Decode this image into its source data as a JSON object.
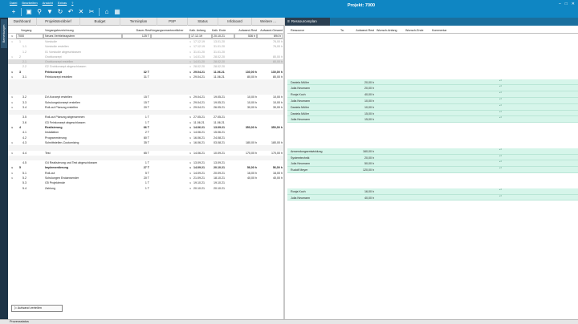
{
  "window": {
    "title": "Projekt: 7000",
    "side_tab": "Bemerkungen"
  },
  "menu": [
    "Datei",
    "Bearbeiten",
    "Ansicht",
    "Extras",
    "?"
  ],
  "tabs": [
    "Dashboard",
    "Projektsteckbrief",
    "Budget",
    "Terminplan",
    "PSP",
    "Status",
    "Infoboard",
    "Weitere ...",
    "Ressourcenplan"
  ],
  "grid": {
    "headers": [
      "Vorgang",
      "Vorgangsbezeichnung",
      "Dauer-Rest",
      "Vorgangsverantwortlicher",
      "Kalk. Anfang",
      "Kalk. Ende",
      "Aufwand-Rest",
      "Aufwand-Gesamt"
    ],
    "project": {
      "id": "7000",
      "name": "Neues Vertriebssystem",
      "dauer": "125 T",
      "verantwortlicher": "",
      "anfang": "17.12.19",
      "ende": "20.10.21",
      "rest": "536 h",
      "gesamt": "694 h"
    },
    "rows": [
      {
        "id": "1",
        "name": "Vorstudie",
        "dauer": "",
        "anfang": "17.12.19",
        "ende": "13.01.20",
        "rest": "",
        "gesamt": "76,00 h",
        "style": "gray",
        "level": 0,
        "toggle": true
      },
      {
        "id": "1.1",
        "name": "Vorstudie erstellen",
        "dauer": "",
        "anfang": "17.12.19",
        "ende": "31.01.20",
        "rest": "",
        "gesamt": "76,00 h",
        "style": "gray",
        "level": 1,
        "toggle": false
      },
      {
        "id": "1.2",
        "name": "01 Vorstudie abgeschlossen",
        "dauer": "",
        "anfang": "31.01.20",
        "ende": "31.01.20",
        "rest": "",
        "gesamt": "",
        "style": "gray",
        "level": 1,
        "toggle": false
      },
      {
        "id": "2",
        "name": "Grobkonzept",
        "dauer": "",
        "anfang": "14.01.20",
        "ende": "28.02.20",
        "rest": "",
        "gesamt": "80,00 h",
        "style": "gray",
        "level": 0,
        "toggle": true
      },
      {
        "id": "2.1",
        "name": "Grobkonzept erstellen",
        "dauer": "",
        "anfang": "14.01.20",
        "ende": "28.02.20",
        "rest": "",
        "gesamt": "80,00 h",
        "style": "gray sel",
        "level": 1,
        "toggle": false
      },
      {
        "id": "2.2",
        "name": "G2 Grobkonzept abgeschlossen",
        "dauer": "",
        "anfang": "28.02.20",
        "ende": "28.02.20",
        "rest": "",
        "gesamt": "",
        "style": "gray",
        "level": 1,
        "toggle": false
      },
      {
        "id": "3",
        "name": "Feinkonzept",
        "dauer": "32 T",
        "anfang": "29.04.21",
        "ende": "11.06.21",
        "rest": "130,00 h",
        "gesamt": "130,00 h",
        "style": "bold",
        "level": 0,
        "toggle": true
      },
      {
        "id": "3.1",
        "name": "Feinkonzept erstellen",
        "dauer": "31 T",
        "anfang": "29.04.21",
        "ende": "11.06.21",
        "rest": "80,00 h",
        "gesamt": "80,00 h",
        "style": "",
        "level": 1,
        "toggle": true
      },
      {
        "id": "",
        "name": "",
        "dauer": "",
        "anfang": "",
        "ende": "",
        "rest": "",
        "gesamt": "",
        "style": "ph",
        "level": 1,
        "toggle": false
      },
      {
        "id": "",
        "name": "",
        "dauer": "",
        "anfang": "",
        "ende": "",
        "rest": "",
        "gesamt": "",
        "style": "ph",
        "level": 1,
        "toggle": false
      },
      {
        "id": "",
        "name": "",
        "dauer": "",
        "anfang": "",
        "ende": "",
        "rest": "",
        "gesamt": "",
        "style": "ph",
        "level": 1,
        "toggle": false
      },
      {
        "id": "3.2",
        "name": "DV-Konzept erstellen",
        "dauer": "15 T",
        "anfang": "29.04.21",
        "ende": "19.05.21",
        "rest": "10,00 h",
        "gesamt": "10,00 h",
        "style": "",
        "level": 1,
        "toggle": true
      },
      {
        "id": "3.3",
        "name": "Schulungskonzept erstellen",
        "dauer": "15 T",
        "anfang": "29.04.21",
        "ende": "19.05.21",
        "rest": "10,00 h",
        "gesamt": "10,00 h",
        "style": "",
        "level": 1,
        "toggle": true
      },
      {
        "id": "3.4",
        "name": "Roll-out Planung erstellen",
        "dauer": "20 T",
        "anfang": "29.04.21",
        "ende": "26.05.21",
        "rest": "30,00 h",
        "gesamt": "30,00 h",
        "style": "",
        "level": 1,
        "toggle": true
      },
      {
        "id": "",
        "name": "",
        "dauer": "",
        "anfang": "",
        "ende": "",
        "rest": "",
        "gesamt": "",
        "style": "ph",
        "level": 1,
        "toggle": false
      },
      {
        "id": "3.5",
        "name": "Roll-out Planung abgenommen",
        "dauer": "1 T",
        "anfang": "27.05.21",
        "ende": "27.05.21",
        "rest": "",
        "gesamt": "",
        "style": "",
        "level": 1,
        "toggle": false
      },
      {
        "id": "3.6",
        "name": "G3 Feinkonzept abgeschlossen",
        "dauer": "1 T",
        "anfang": "11.06.21",
        "ende": "11.06.21",
        "rest": "",
        "gesamt": "",
        "style": "",
        "level": 1,
        "toggle": false
      },
      {
        "id": "4",
        "name": "Realisierung",
        "dauer": "66 T",
        "anfang": "14.06.21",
        "ende": "13.09.21",
        "rest": "350,00 h",
        "gesamt": "350,00 h",
        "style": "bold",
        "level": 0,
        "toggle": true
      },
      {
        "id": "4.1",
        "name": "Installation",
        "dauer": "2 T",
        "anfang": "14.06.21",
        "ende": "15.06.21",
        "rest": "",
        "gesamt": "",
        "style": "",
        "level": 1,
        "toggle": false
      },
      {
        "id": "4.2",
        "name": "Programmierung",
        "dauer": "80 T",
        "anfang": "16.06.21",
        "ende": "24.08.21",
        "rest": "",
        "gesamt": "",
        "style": "",
        "level": 1,
        "toggle": false
      },
      {
        "id": "4.3",
        "name": "Schnittstellen-Customizing",
        "dauer": "35 T",
        "anfang": "16.06.21",
        "ende": "03.08.21",
        "rest": "180,00 h",
        "gesamt": "180,00 h",
        "style": "",
        "level": 1,
        "toggle": true
      },
      {
        "id": "",
        "name": "",
        "dauer": "",
        "anfang": "",
        "ende": "",
        "rest": "",
        "gesamt": "",
        "style": "ph",
        "level": 1,
        "toggle": false
      },
      {
        "id": "4.4",
        "name": "Test",
        "dauer": "65 T",
        "anfang": "14.06.21",
        "ende": "10.09.21",
        "rest": "170,00 h",
        "gesamt": "170,00 h",
        "style": "",
        "level": 1,
        "toggle": true
      },
      {
        "id": "",
        "name": "",
        "dauer": "",
        "anfang": "",
        "ende": "",
        "rest": "",
        "gesamt": "",
        "style": "ph",
        "level": 1,
        "toggle": false
      },
      {
        "id": "4.5",
        "name": "G4 Realisierung und Test abgeschlossen",
        "dauer": "1 T",
        "anfang": "13.09.21",
        "ende": "13.09.21",
        "rest": "",
        "gesamt": "",
        "style": "",
        "level": 1,
        "toggle": false
      },
      {
        "id": "5",
        "name": "Implementierung",
        "dauer": "27 T",
        "anfang": "14.09.21",
        "ende": "20.10.21",
        "rest": "56,00 h",
        "gesamt": "56,00 h",
        "style": "bold",
        "level": 0,
        "toggle": true
      },
      {
        "id": "5.1",
        "name": "Roll-out",
        "dauer": "5 T",
        "anfang": "14.09.21",
        "ende": "20.09.21",
        "rest": "16,00 h",
        "gesamt": "16,00 h",
        "style": "",
        "level": 1,
        "toggle": true
      },
      {
        "id": "5.2",
        "name": "Schulungen Endanwender",
        "dauer": "20 T",
        "anfang": "21.09.21",
        "ende": "18.10.21",
        "rest": "40,00 h",
        "gesamt": "40,00 h",
        "style": "",
        "level": 1,
        "toggle": true
      },
      {
        "id": "5.3",
        "name": "G5 Projektende",
        "dauer": "1 T",
        "anfang": "19.10.21",
        "ende": "19.10.21",
        "rest": "",
        "gesamt": "",
        "style": "",
        "level": 1,
        "toggle": false
      },
      {
        "id": "5.4",
        "name": "Zahlung",
        "dauer": "1 T",
        "anfang": "20.10.21",
        "ende": "20.10.21",
        "rest": "",
        "gesamt": "",
        "style": "",
        "level": 1,
        "toggle": false
      }
    ]
  },
  "resources": {
    "headers": [
      "Ressource",
      "Ta.",
      "Aufwand-Rest",
      "Wunsch-Anfang",
      "Wunsch-Ende",
      "Kommentar"
    ],
    "rows": [
      {
        "gap": 9
      },
      {
        "name": "Daniela Müller",
        "rest": "20,00 h"
      },
      {
        "name": "Julia Neumann",
        "rest": "20,00 h"
      },
      {
        "name": "Ronja Koch",
        "rest": "40,00 h"
      },
      {
        "name": "Julia Neumann",
        "rest": "10,00 h"
      },
      {
        "name": "Daniela Müller",
        "rest": "10,00 h"
      },
      {
        "name": "Daniela Müller",
        "rest": "15,00 h"
      },
      {
        "name": "Julia Neumann",
        "rest": "15,00 h"
      },
      {
        "gap": 5
      },
      {
        "name": "Anwendungsentwicklung",
        "rest": "160,00 h"
      },
      {
        "name": "Systemtechnik",
        "rest": "20,00 h"
      },
      {
        "name": "Julia Neumann",
        "rest": "50,00 h"
      },
      {
        "name": "Rudolf Meyer",
        "rest": "120,00 h"
      },
      {
        "gap": 3
      },
      {
        "name": "Ronja Koch",
        "rest": "16,00 h"
      },
      {
        "name": "Julia Neumann",
        "rest": "40,00 h"
      }
    ]
  },
  "footer": {
    "button": "Aufwand verteilen",
    "status": "Prozessstatus"
  }
}
